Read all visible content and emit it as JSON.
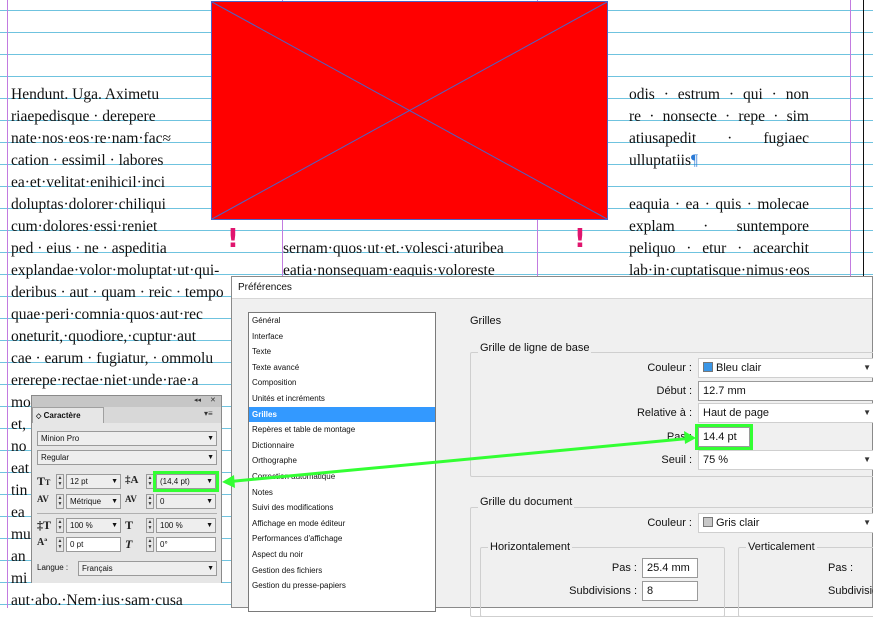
{
  "document": {
    "left_column": [
      "Hendunt. Uga. Aximetu",
      "riaepedisque · derepere",
      "nate·nos·eos·re·nam·fac≈",
      "cation · essimil · labores",
      "ea·et·velitat·enihicil·inci",
      "doluptas·dolorer·chiliqui",
      "cum·dolores·essi·reniet",
      "ped · eius · ne · aspeditia",
      "explandae·volor·moluptat·ut·qui-",
      "deribus · aut · quam · reic · tempo",
      "quae·peri·comnia·quos·aut·rec",
      "oneturit,·quodiore,·cuptur·aut",
      "cae · earum · fugiatur, · ommolu",
      "ererepe·rectae·niet·unde·rae·a",
      "mo",
      "et,",
      "no",
      "eat",
      "tin",
      "ea",
      "mu",
      "an",
      "mi",
      "aut·abo.·Nem·ius·sam·cusa"
    ],
    "right_column": [
      "odis · estrum · qui · non",
      "re · nonsecte · repe · sim",
      "atiusapedit · fugiaec",
      "ulluptatiis",
      "",
      "eaquia · ea · quis · molecae",
      "explam · suntempore",
      "peliquo · etur · acearchit",
      "lab·in·cuptatisque·nimus·eosam·et"
    ],
    "middle_column": [
      "sernam·quos·ut·et.·volesci·aturibea",
      "eatia·nonsequam·eaquis·voloreste"
    ],
    "pilcrow": "¶",
    "exclamation": "!"
  },
  "preferences": {
    "title": "Préférences",
    "categories": [
      "Général",
      "Interface",
      "Texte",
      "Texte avancé",
      "Composition",
      "Unités et incréments",
      "Grilles",
      "Repères et table de montage",
      "Dictionnaire",
      "Orthographe",
      "Correction automatique",
      "Notes",
      "Suivi des modifications",
      "Affichage en mode éditeur",
      "Performances d'affichage",
      "Aspect du noir",
      "Gestion des fichiers",
      "Gestion du presse-papiers"
    ],
    "selected_category": "Grilles",
    "panel_title": "Grilles",
    "baseline_grid": {
      "heading": "Grille de ligne de base",
      "color_label": "Couleur :",
      "color_value": "Bleu clair",
      "color_swatch": "#3a96e6",
      "start_label": "Début :",
      "start_value": "12.7 mm",
      "relative_label": "Relative à :",
      "relative_value": "Haut de page",
      "increment_label": "Pas :",
      "increment_value": "14.4 pt",
      "threshold_label": "Seuil :",
      "threshold_value": "75 %"
    },
    "document_grid": {
      "heading": "Grille du document",
      "color_label": "Couleur :",
      "color_value": "Gris clair",
      "color_swatch": "#c8c8c8",
      "horizontal_heading": "Horizontalement",
      "h_step_label": "Pas :",
      "h_step_value": "25.4 mm",
      "h_subdiv_label": "Subdivisions :",
      "h_subdiv_value": "8",
      "vertical_heading": "Verticalement",
      "v_step_label": "Pas :",
      "v_subdiv_label": "Subdivisio"
    }
  },
  "character_panel": {
    "title": "Caractère",
    "collapse": "◂◂",
    "close": "✕",
    "font_family": "Minion Pro",
    "font_style": "Regular",
    "font_size": "12 pt",
    "leading": "(14,4 pt)",
    "kerning": "Métrique",
    "tracking": "0",
    "vertical_scale": "100 %",
    "horizontal_scale": "100 %",
    "baseline_shift": "0 pt",
    "skew": "0°",
    "language_label": "Langue :",
    "language": "Français"
  },
  "colors": {
    "highlight": "#33ff33",
    "placeholder_fill": "#ff0000",
    "selection": "#3399ff"
  }
}
